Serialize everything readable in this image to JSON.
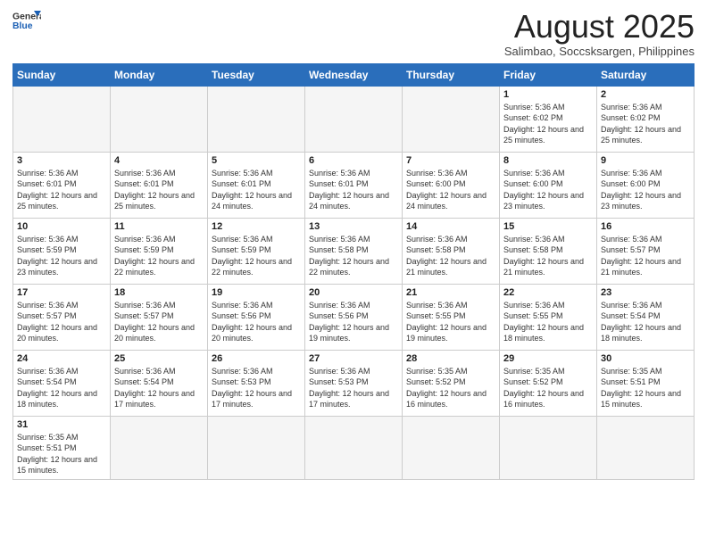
{
  "logo": {
    "general": "General",
    "blue": "Blue"
  },
  "header": {
    "month_year": "August 2025",
    "location": "Salimbao, Soccsksargen, Philippines"
  },
  "weekdays": [
    "Sunday",
    "Monday",
    "Tuesday",
    "Wednesday",
    "Thursday",
    "Friday",
    "Saturday"
  ],
  "weeks": [
    [
      {
        "day": "",
        "info": ""
      },
      {
        "day": "",
        "info": ""
      },
      {
        "day": "",
        "info": ""
      },
      {
        "day": "",
        "info": ""
      },
      {
        "day": "",
        "info": ""
      },
      {
        "day": "1",
        "info": "Sunrise: 5:36 AM\nSunset: 6:02 PM\nDaylight: 12 hours and 25 minutes."
      },
      {
        "day": "2",
        "info": "Sunrise: 5:36 AM\nSunset: 6:02 PM\nDaylight: 12 hours and 25 minutes."
      }
    ],
    [
      {
        "day": "3",
        "info": "Sunrise: 5:36 AM\nSunset: 6:01 PM\nDaylight: 12 hours and 25 minutes."
      },
      {
        "day": "4",
        "info": "Sunrise: 5:36 AM\nSunset: 6:01 PM\nDaylight: 12 hours and 25 minutes."
      },
      {
        "day": "5",
        "info": "Sunrise: 5:36 AM\nSunset: 6:01 PM\nDaylight: 12 hours and 24 minutes."
      },
      {
        "day": "6",
        "info": "Sunrise: 5:36 AM\nSunset: 6:01 PM\nDaylight: 12 hours and 24 minutes."
      },
      {
        "day": "7",
        "info": "Sunrise: 5:36 AM\nSunset: 6:00 PM\nDaylight: 12 hours and 24 minutes."
      },
      {
        "day": "8",
        "info": "Sunrise: 5:36 AM\nSunset: 6:00 PM\nDaylight: 12 hours and 23 minutes."
      },
      {
        "day": "9",
        "info": "Sunrise: 5:36 AM\nSunset: 6:00 PM\nDaylight: 12 hours and 23 minutes."
      }
    ],
    [
      {
        "day": "10",
        "info": "Sunrise: 5:36 AM\nSunset: 5:59 PM\nDaylight: 12 hours and 23 minutes."
      },
      {
        "day": "11",
        "info": "Sunrise: 5:36 AM\nSunset: 5:59 PM\nDaylight: 12 hours and 22 minutes."
      },
      {
        "day": "12",
        "info": "Sunrise: 5:36 AM\nSunset: 5:59 PM\nDaylight: 12 hours and 22 minutes."
      },
      {
        "day": "13",
        "info": "Sunrise: 5:36 AM\nSunset: 5:58 PM\nDaylight: 12 hours and 22 minutes."
      },
      {
        "day": "14",
        "info": "Sunrise: 5:36 AM\nSunset: 5:58 PM\nDaylight: 12 hours and 21 minutes."
      },
      {
        "day": "15",
        "info": "Sunrise: 5:36 AM\nSunset: 5:58 PM\nDaylight: 12 hours and 21 minutes."
      },
      {
        "day": "16",
        "info": "Sunrise: 5:36 AM\nSunset: 5:57 PM\nDaylight: 12 hours and 21 minutes."
      }
    ],
    [
      {
        "day": "17",
        "info": "Sunrise: 5:36 AM\nSunset: 5:57 PM\nDaylight: 12 hours and 20 minutes."
      },
      {
        "day": "18",
        "info": "Sunrise: 5:36 AM\nSunset: 5:57 PM\nDaylight: 12 hours and 20 minutes."
      },
      {
        "day": "19",
        "info": "Sunrise: 5:36 AM\nSunset: 5:56 PM\nDaylight: 12 hours and 20 minutes."
      },
      {
        "day": "20",
        "info": "Sunrise: 5:36 AM\nSunset: 5:56 PM\nDaylight: 12 hours and 19 minutes."
      },
      {
        "day": "21",
        "info": "Sunrise: 5:36 AM\nSunset: 5:55 PM\nDaylight: 12 hours and 19 minutes."
      },
      {
        "day": "22",
        "info": "Sunrise: 5:36 AM\nSunset: 5:55 PM\nDaylight: 12 hours and 18 minutes."
      },
      {
        "day": "23",
        "info": "Sunrise: 5:36 AM\nSunset: 5:54 PM\nDaylight: 12 hours and 18 minutes."
      }
    ],
    [
      {
        "day": "24",
        "info": "Sunrise: 5:36 AM\nSunset: 5:54 PM\nDaylight: 12 hours and 18 minutes."
      },
      {
        "day": "25",
        "info": "Sunrise: 5:36 AM\nSunset: 5:54 PM\nDaylight: 12 hours and 17 minutes."
      },
      {
        "day": "26",
        "info": "Sunrise: 5:36 AM\nSunset: 5:53 PM\nDaylight: 12 hours and 17 minutes."
      },
      {
        "day": "27",
        "info": "Sunrise: 5:36 AM\nSunset: 5:53 PM\nDaylight: 12 hours and 17 minutes."
      },
      {
        "day": "28",
        "info": "Sunrise: 5:35 AM\nSunset: 5:52 PM\nDaylight: 12 hours and 16 minutes."
      },
      {
        "day": "29",
        "info": "Sunrise: 5:35 AM\nSunset: 5:52 PM\nDaylight: 12 hours and 16 minutes."
      },
      {
        "day": "30",
        "info": "Sunrise: 5:35 AM\nSunset: 5:51 PM\nDaylight: 12 hours and 15 minutes."
      }
    ],
    [
      {
        "day": "31",
        "info": "Sunrise: 5:35 AM\nSunset: 5:51 PM\nDaylight: 12 hours and 15 minutes."
      },
      {
        "day": "",
        "info": ""
      },
      {
        "day": "",
        "info": ""
      },
      {
        "day": "",
        "info": ""
      },
      {
        "day": "",
        "info": ""
      },
      {
        "day": "",
        "info": ""
      },
      {
        "day": "",
        "info": ""
      }
    ]
  ]
}
